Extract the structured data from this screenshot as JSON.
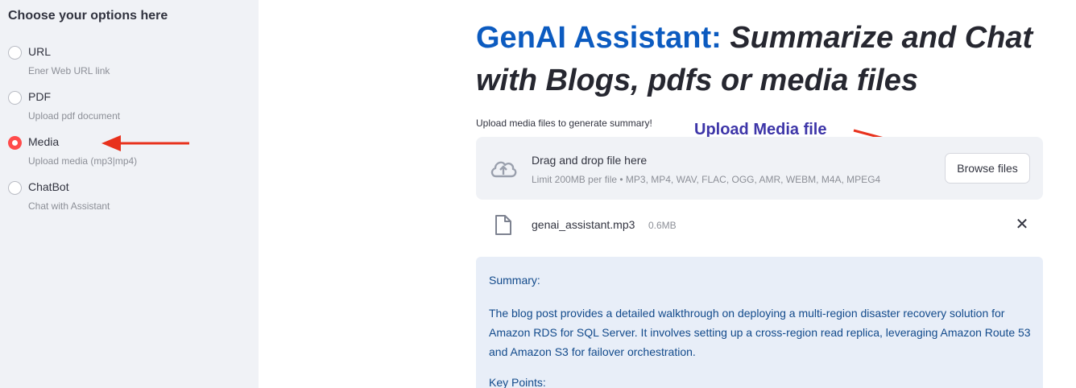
{
  "sidebar": {
    "title": "Choose your options here",
    "options": [
      {
        "label": "URL",
        "caption": "Ener Web URL link",
        "selected": false
      },
      {
        "label": "PDF",
        "caption": "Upload pdf document",
        "selected": false
      },
      {
        "label": "Media",
        "caption": "Upload media (mp3|mp4)",
        "selected": true
      },
      {
        "label": "ChatBot",
        "caption": "Chat with Assistant",
        "selected": false
      }
    ]
  },
  "main": {
    "title_accent": "GenAI Assistant:",
    "title_rest": "Summarize and Chat with Blogs, pdfs or media files",
    "uploader_label": "Upload media files to generate summary!",
    "annotation": "Upload Media file",
    "dropzone": {
      "title": "Drag and drop file here",
      "limit": "Limit 200MB per file • MP3, MP4, WAV, FLAC, OGG, AMR, WEBM, M4A, MPEG4",
      "browse_label": "Browse files",
      "icon": "cloud-upload-icon"
    },
    "file": {
      "name": "genai_assistant.mp3",
      "size": "0.6MB",
      "icon": "file-icon",
      "remove_icon": "close-icon",
      "remove_glyph": "✕"
    },
    "summary": {
      "heading": "Summary:",
      "text": "The blog post provides a detailed walkthrough on deploying a multi-region disaster recovery solution for Amazon RDS for SQL Server. It involves setting up a cross-region read replica, leveraging Amazon Route 53 and Amazon S3 for failover orchestration.",
      "key_points": "Key Points:"
    }
  },
  "colors": {
    "accent_blue": "#0c5bc0",
    "selected_radio": "#ff4b4b",
    "annotation_red": "#e8311c",
    "annotation_purple": "#3d35a8",
    "summary_bg": "#e8eef8",
    "summary_text": "#124a8b",
    "sidebar_bg": "#f0f2f6"
  }
}
